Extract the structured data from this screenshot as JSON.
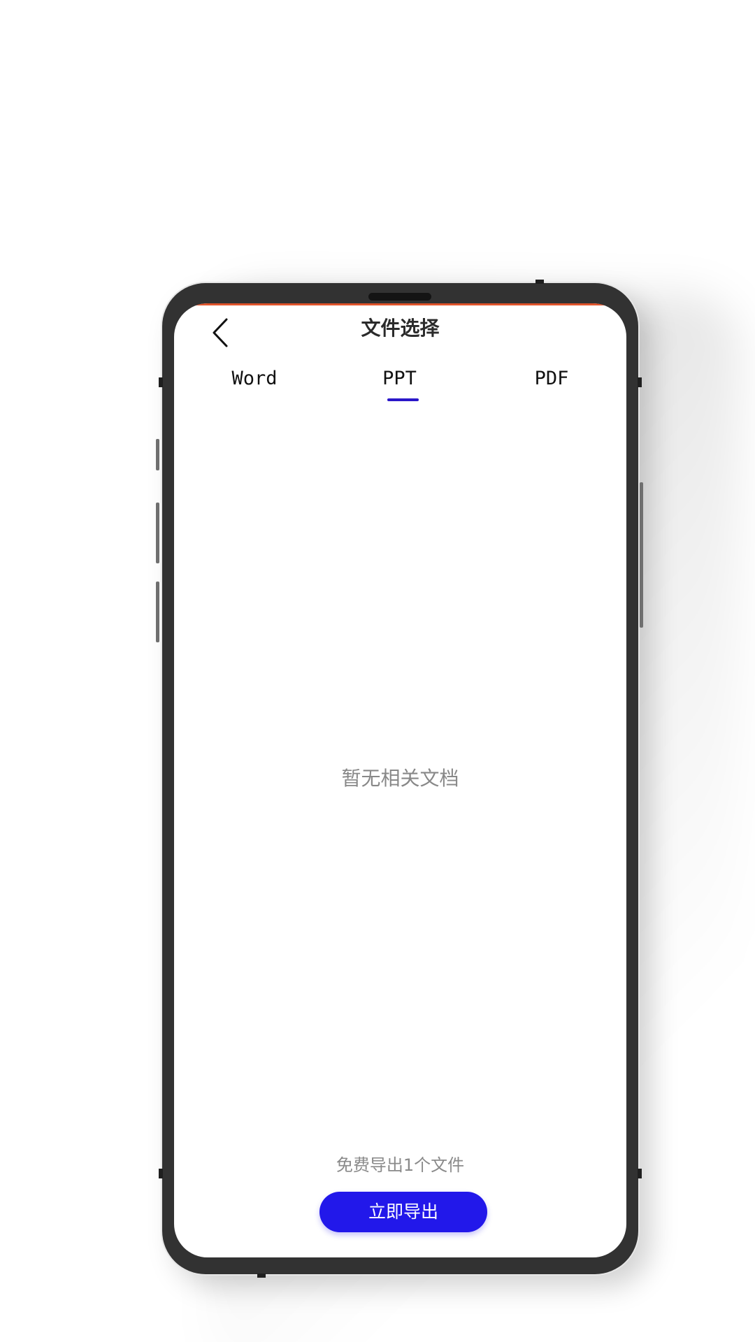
{
  "header": {
    "title": "文件选择",
    "back_icon": "chevron-left-icon"
  },
  "tabs": [
    {
      "label": "Word",
      "selected": false
    },
    {
      "label": "PPT",
      "selected": true
    },
    {
      "label": "PDF",
      "selected": false
    }
  ],
  "empty_state": {
    "message": "暂无相关文档"
  },
  "footer": {
    "note": "免费导出1个文件",
    "export_label": "立即导出"
  },
  "colors": {
    "accent": "#2218ea",
    "tab_indicator": "#2a17c9",
    "status_bar_accent": "#e0542b",
    "phone_frame": "#323232"
  }
}
